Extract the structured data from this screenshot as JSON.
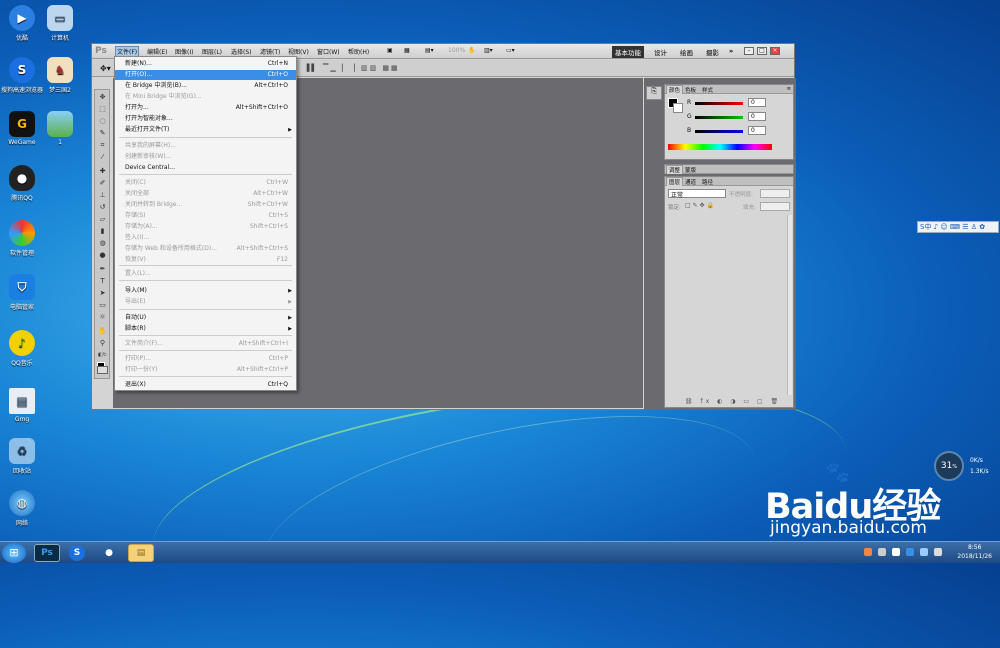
{
  "desktop": {
    "icons": [
      {
        "label": "优酷"
      },
      {
        "label": "计算机"
      },
      {
        "label": "搜狗高速浏览器"
      },
      {
        "label": "梦三国2"
      },
      {
        "label": "WeGame"
      },
      {
        "label": "1"
      },
      {
        "label": "腾讯QQ"
      },
      {
        "label": "软件管理"
      },
      {
        "label": "电脑管家"
      },
      {
        "label": "QQ音乐"
      },
      {
        "label": "Gmg"
      },
      {
        "label": "回收站"
      },
      {
        "label": "网络"
      }
    ]
  },
  "photoshop": {
    "logo": "Ps",
    "menus": [
      "文件(F)",
      "编辑(E)",
      "图像(I)",
      "图层(L)",
      "选择(S)",
      "滤镜(T)",
      "视图(V)",
      "窗口(W)",
      "帮助(H)"
    ],
    "zoom": "100%",
    "workspaces": [
      "基本功能",
      "设计",
      "绘画",
      "摄影"
    ],
    "more": "»",
    "window_buttons": [
      "–",
      "□",
      "×"
    ],
    "color_panel": {
      "tabs": [
        "颜色",
        "色板",
        "样式"
      ],
      "channels": [
        {
          "label": "R",
          "value": "0"
        },
        {
          "label": "G",
          "value": "0"
        },
        {
          "label": "B",
          "value": "0"
        }
      ]
    },
    "adjust_panel": {
      "tabs": [
        "调整",
        "蒙版"
      ]
    },
    "layers_panel": {
      "tabs": [
        "图层",
        "通道",
        "路径"
      ],
      "blend_mode": "正常",
      "opacity_label": "不透明度:",
      "lock_label": "锁定:",
      "fill_label": "填充:"
    }
  },
  "file_menu": {
    "items": [
      {
        "label": "新建(N)...",
        "shortcut": "Ctrl+N"
      },
      {
        "label": "打开(O)...",
        "shortcut": "Ctrl+O"
      },
      {
        "label": "在 Bridge 中浏览(B)...",
        "shortcut": "Alt+Ctrl+O"
      },
      {
        "label": "在 Mini Bridge 中浏览(G)...",
        "shortcut": ""
      },
      {
        "label": "打开为...",
        "shortcut": "Alt+Shift+Ctrl+O"
      },
      {
        "label": "打开为智能对象...",
        "shortcut": ""
      },
      {
        "label": "最近打开文件(T)",
        "shortcut": ""
      },
      {
        "label": "共享我的屏幕(H)...",
        "shortcut": ""
      },
      {
        "label": "创建新审核(W)...",
        "shortcut": ""
      },
      {
        "label": "Device Central...",
        "shortcut": ""
      },
      {
        "label": "关闭(C)",
        "shortcut": "Ctrl+W"
      },
      {
        "label": "关闭全部",
        "shortcut": "Alt+Ctrl+W"
      },
      {
        "label": "关闭并转到 Bridge...",
        "shortcut": "Shift+Ctrl+W"
      },
      {
        "label": "存储(S)",
        "shortcut": "Ctrl+S"
      },
      {
        "label": "存储为(A)...",
        "shortcut": "Shift+Ctrl+S"
      },
      {
        "label": "签入(I)...",
        "shortcut": ""
      },
      {
        "label": "存储为 Web 和设备所用格式(D)...",
        "shortcut": "Alt+Shift+Ctrl+S"
      },
      {
        "label": "恢复(V)",
        "shortcut": "F12"
      },
      {
        "label": "置入(L)...",
        "shortcut": ""
      },
      {
        "label": "导入(M)",
        "shortcut": ""
      },
      {
        "label": "导出(E)",
        "shortcut": ""
      },
      {
        "label": "自动(U)",
        "shortcut": ""
      },
      {
        "label": "脚本(R)",
        "shortcut": ""
      },
      {
        "label": "文件简介(F)...",
        "shortcut": "Alt+Shift+Ctrl+I"
      },
      {
        "label": "打印(P)...",
        "shortcut": "Ctrl+P"
      },
      {
        "label": "打印一份(Y)",
        "shortcut": "Alt+Shift+Ctrl+P"
      },
      {
        "label": "退出(X)",
        "shortcut": "Ctrl+Q"
      }
    ]
  },
  "ime_bar": "S中 ♪ ☺ ⌨ ☰ ♙ ✿",
  "net_monitor": {
    "percent": "31",
    "unit": "%",
    "up": "0K/s",
    "down": "1.3K/s"
  },
  "watermark": {
    "logo": "Baidu经验",
    "url": "jingyan.baidu.com"
  },
  "taskbar": {
    "start": "⊞",
    "clock_time": "8:56",
    "clock_date": "2018/11/26"
  },
  "colors": {
    "accent": "#3a8ee6",
    "canvas": "#6b6a6f"
  }
}
